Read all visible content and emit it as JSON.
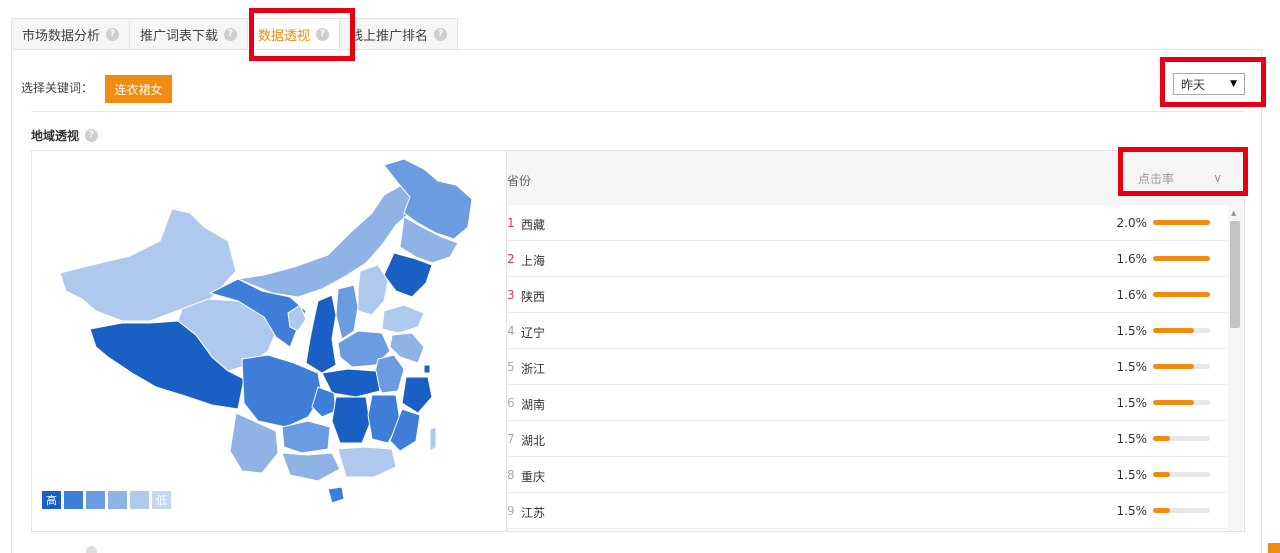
{
  "tabs": [
    {
      "label": "市场数据分析",
      "active": false
    },
    {
      "label": "推广词表下载",
      "active": false
    },
    {
      "label": "数据透视",
      "active": true
    },
    {
      "label": "线上推广排名",
      "active": false
    }
  ],
  "help_glyph": "?",
  "keyword": {
    "label": "选择关键词：",
    "value": "连衣裙女"
  },
  "date_select": {
    "value": "昨天",
    "arrow": "▼"
  },
  "section": {
    "title": "地域透视"
  },
  "table": {
    "header_province": "省份",
    "header_metric": "点击率",
    "metric_arrow": "∨",
    "rows": [
      {
        "rank": "1",
        "province": "西藏",
        "value": "2.0%",
        "fill": 1.0
      },
      {
        "rank": "2",
        "province": "上海",
        "value": "1.6%",
        "fill": 1.0
      },
      {
        "rank": "3",
        "province": "陕西",
        "value": "1.6%",
        "fill": 1.0
      },
      {
        "rank": "4",
        "province": "辽宁",
        "value": "1.5%",
        "fill": 0.72
      },
      {
        "rank": "5",
        "province": "浙江",
        "value": "1.5%",
        "fill": 0.72
      },
      {
        "rank": "6",
        "province": "湖南",
        "value": "1.5%",
        "fill": 0.72
      },
      {
        "rank": "7",
        "province": "湖北",
        "value": "1.5%",
        "fill": 0.3
      },
      {
        "rank": "8",
        "province": "重庆",
        "value": "1.5%",
        "fill": 0.3
      },
      {
        "rank": "9",
        "province": "江苏",
        "value": "1.5%",
        "fill": 0.3
      }
    ]
  },
  "legend": {
    "high": "高",
    "low": "低"
  },
  "colors": {
    "accent": "#f28c11",
    "highlight": "#e60012",
    "map_levels": [
      "#1a5fc4",
      "#3f7ed8",
      "#6b9be0",
      "#90b3e6",
      "#afc8ee"
    ]
  }
}
